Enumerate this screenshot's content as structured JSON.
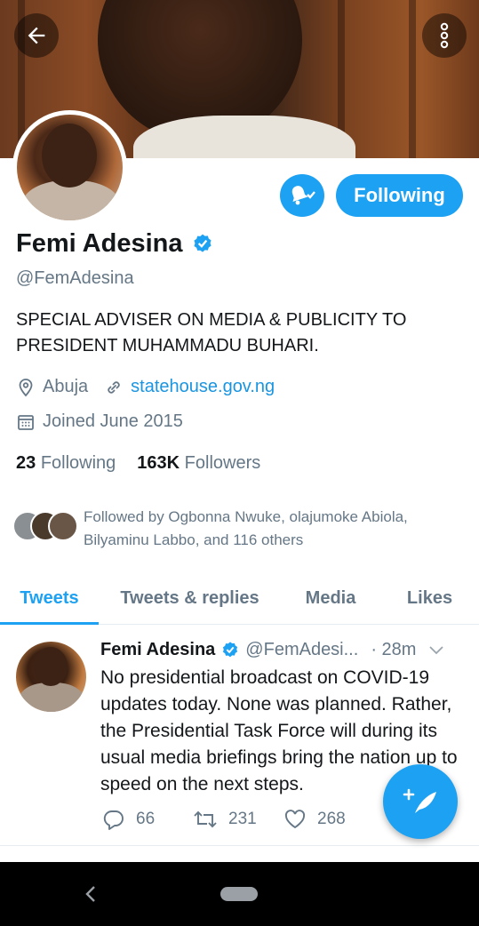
{
  "profile": {
    "name": "Femi Adesina",
    "handle": "@FemAdesina",
    "bio": "SPECIAL ADVISER ON MEDIA & PUBLICITY TO PRESIDENT MUHAMMADU BUHARI.",
    "location": "Abuja",
    "website": "statehouse.gov.ng",
    "joined": "Joined June 2015",
    "following_count": "23",
    "following_label": "Following",
    "followers_count": "163K",
    "followers_label": "Followers",
    "followed_by": "Followed by Ogbonna Nwuke, olajumoke Abiola, Bilyaminu Labbo, and 116 others",
    "follow_button": "Following"
  },
  "tabs": [
    {
      "label": "Tweets",
      "active": true
    },
    {
      "label": "Tweets & replies",
      "active": false
    },
    {
      "label": "Media",
      "active": false
    },
    {
      "label": "Likes",
      "active": false
    }
  ],
  "tweet": {
    "author": "Femi Adesina",
    "handle": "@FemAdesi...",
    "time": "· 28m",
    "text": "No presidential broadcast on COVID-19 updates today. None was planned. Rather, the Presidential Task Force will during its usual  media briefings bring the nation up to speed on the next steps.",
    "replies": "66",
    "retweets": "231",
    "likes": "268"
  },
  "colors": {
    "accent": "#1da1f2",
    "link": "#1b95e0",
    "muted": "#657786"
  },
  "icons": [
    "back-arrow-icon",
    "more-vertical-icon",
    "bell-check-icon",
    "verified-icon",
    "location-pin-icon",
    "link-icon",
    "calendar-icon",
    "reply-icon",
    "retweet-icon",
    "like-icon",
    "compose-icon",
    "nav-back-icon"
  ]
}
